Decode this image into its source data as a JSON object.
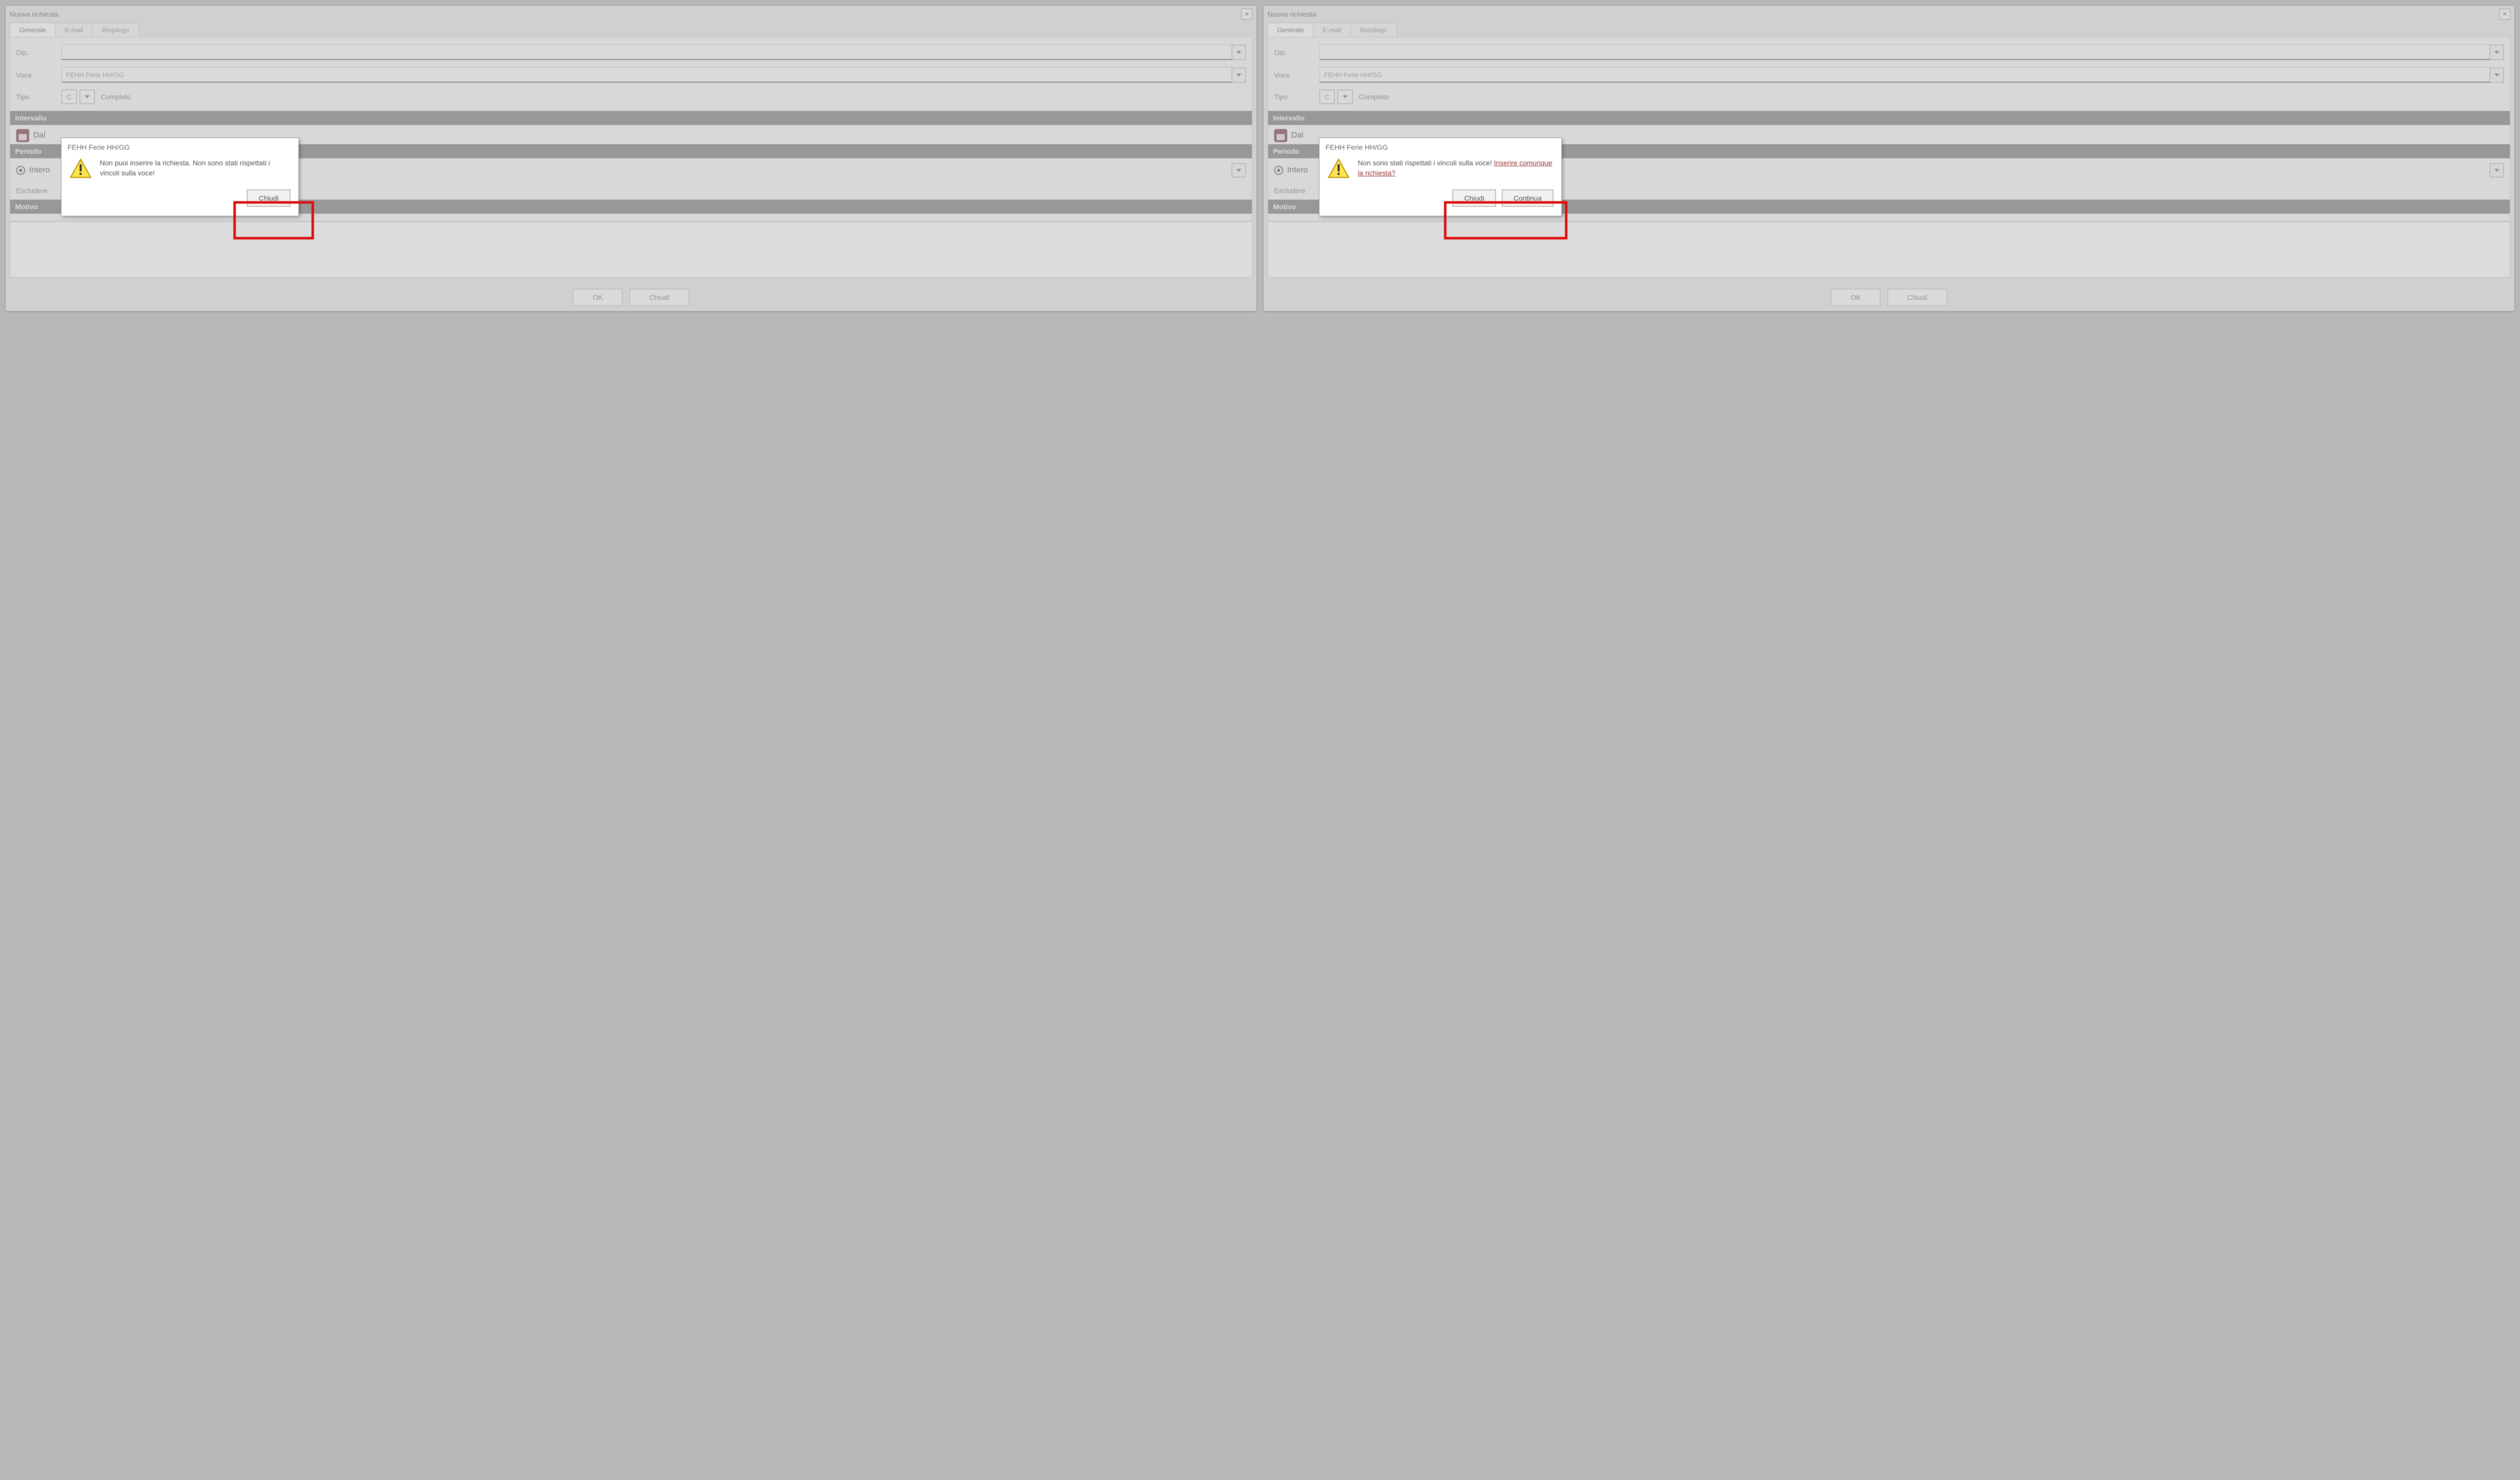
{
  "left": {
    "window_title": "Nuova richiesta",
    "tabs": {
      "t1": "Generale",
      "t2": "E-mail",
      "t3": "Riepilogo"
    },
    "fields": {
      "dip_label": "Dip.",
      "dip_value": "",
      "voce_label": "Voce",
      "voce_value": "FEHH Ferie HH/GG",
      "tipo_label": "Tipo",
      "tipo_code": "C",
      "tipo_text": "Completo"
    },
    "sections": {
      "intervallo": "Intervallo",
      "dal_label": "Dal",
      "periodo": "Periodo",
      "intero_label": "Intero",
      "escludere": "Escludere",
      "motivo": "Motivo"
    },
    "footer": {
      "ok": "OK",
      "close": "Chiudi"
    },
    "popup": {
      "title": "FEHH Ferie HH/GG",
      "message": "Non puoi inserire la richiesta. Non sono stati rispettati i vincoli sulla voce!",
      "close": "Chiudi"
    }
  },
  "right": {
    "window_title": "Nuova richiesta",
    "tabs": {
      "t1": "Generale",
      "t2": "E-mail",
      "t3": "Riepilogo"
    },
    "fields": {
      "dip_label": "Dip.",
      "dip_value": "",
      "voce_label": "Voce",
      "voce_value": "FEHH Ferie HH/GG",
      "tipo_label": "Tipo",
      "tipo_code": "C",
      "tipo_text": "Completo"
    },
    "sections": {
      "intervallo": "Intervallo",
      "dal_label": "Dal",
      "periodo": "Periodo",
      "intero_label": "Intero",
      "escludere": "Escludere",
      "motivo": "Motivo"
    },
    "footer": {
      "ok": "OK",
      "close": "Chiudi"
    },
    "popup": {
      "title": "FEHH Ferie HH/GG",
      "message_plain": "Non sono stati rispettati i vincoli sulla voce! ",
      "message_question": "Inserire comunque la richiesta?",
      "close": "Chiudi",
      "continue": "Continua"
    }
  }
}
